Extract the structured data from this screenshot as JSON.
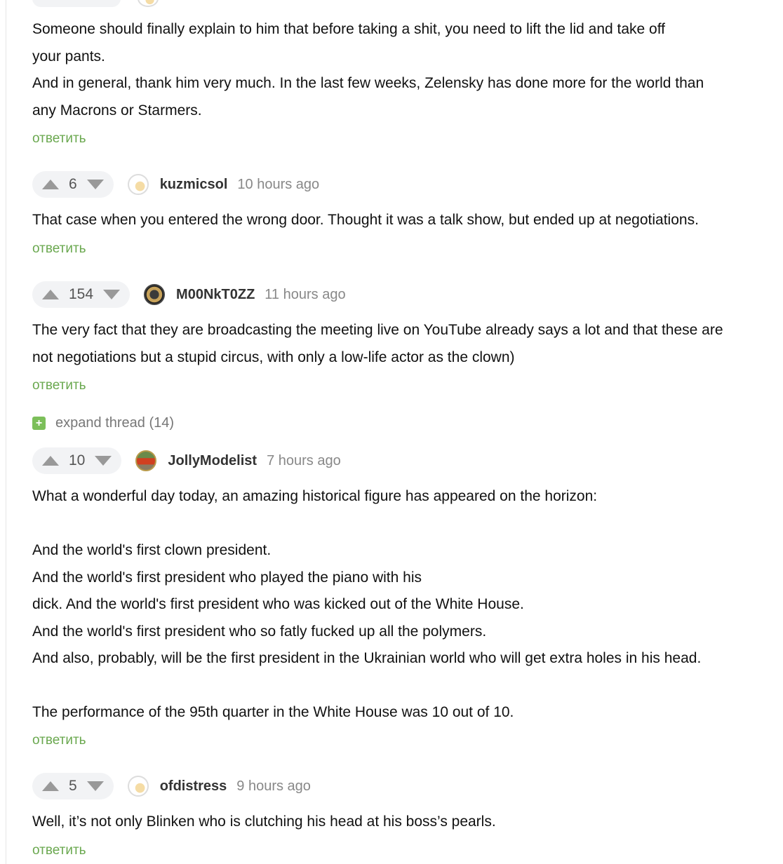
{
  "comments": [
    {
      "text": "Someone should finally explain to him that before taking a shit, you need to lift the lid and take off\nyour pants.\nAnd in general, thank him very much. In the last few weeks, Zelensky has done more for the world than\nany Macrons or Starmers.",
      "reply_label": "ответить"
    },
    {
      "score": "6",
      "username": "kuzmicsol",
      "time": "10 hours ago",
      "text": "That case when you entered the wrong door. Thought it was a talk show, but ended up at negotiations.",
      "reply_label": "ответить"
    },
    {
      "score": "154",
      "username": "M00NkT0ZZ",
      "time": "11 hours ago",
      "text": "The very fact that they are broadcasting the meeting live on YouTube already says a lot and that these are\nnot negotiations but a stupid circus, with only a low-life actor as the clown)",
      "reply_label": "ответить"
    },
    {
      "score": "10",
      "username": "JollyModelist",
      "time": "7 hours ago",
      "text": "What a wonderful day today, an amazing historical figure has appeared on the horizon:\n\nAnd the world's first clown president.\nAnd the world's first president who played the piano with his\ndick. And the world's first president who was kicked out of the White House.\nAnd the world's first president who so fatly fucked up all the polymers.\nAnd also, probably, will be the first president in the Ukrainian world who will get extra holes in his head.\n\nThe performance of the 95th quarter in the White House was 10 out of 10.",
      "reply_label": "ответить"
    },
    {
      "score": "5",
      "username": "ofdistress",
      "time": "9 hours ago",
      "text": "Well, it’s not only Blinken who is clutching his head at his boss’s pearls.",
      "reply_label": "ответить"
    }
  ],
  "expand_thread": {
    "icon": "+",
    "label": "expand thread (14)"
  },
  "icons": {
    "upvote": "upvote-icon",
    "downvote": "downvote-icon",
    "expand": "plus-icon"
  },
  "colors": {
    "reply": "#6aa84f",
    "expand_icon": "#7cbf5a",
    "vote_bg": "#f2f3f5"
  }
}
